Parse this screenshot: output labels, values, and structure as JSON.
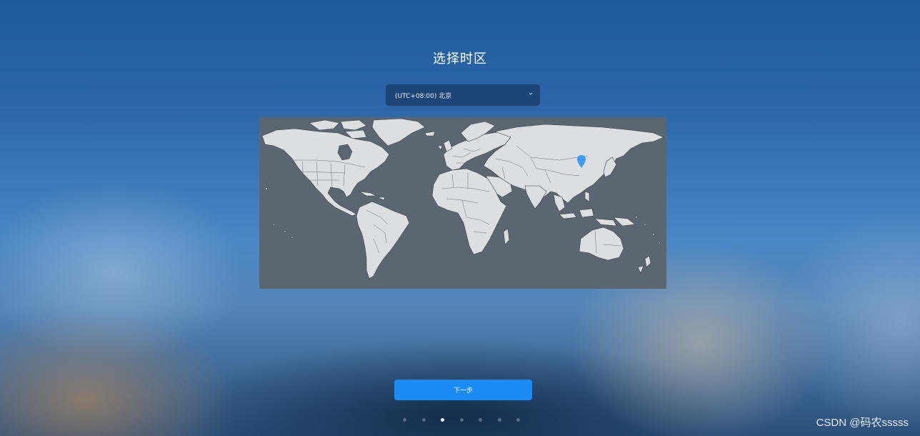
{
  "page": {
    "title": "选择时区",
    "background_style": "blurred blue sky wallpaper"
  },
  "timezone_select": {
    "value": "(UTC+08:00) 北京",
    "icon": "chevron-down-icon"
  },
  "map": {
    "selected_city": "北京",
    "marker_icon": "map-pin-icon",
    "marker_color": "#3d9bf5",
    "land_color": "#dcdfe2",
    "ocean_color": "#5c6670"
  },
  "next_button": {
    "label": "下一步",
    "color": "#1b8cf5"
  },
  "pagination": {
    "total": 7,
    "current": 3
  },
  "watermark": {
    "text": "CSDN @码农sssss"
  }
}
